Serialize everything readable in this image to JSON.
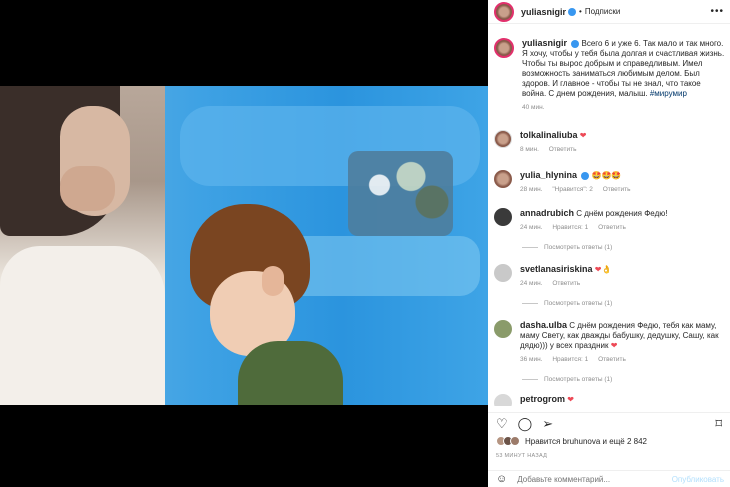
{
  "post": {
    "author": "yuliasnigir",
    "follow_label": "Подписки",
    "caption": "Всего 6 и уже 6. Так мало и так много. Я хочу, чтобы у тебя была долгая и счастливая жизнь. Чтобы ты вырос добрым и справедливым. Имел возможность заниматься любимым делом. Был здоров. И главное - чтобы ты не знал, что такое война. С днем рождения, малыш.",
    "hashtag": "#мирумир",
    "caption_time": "40 мин."
  },
  "comments": [
    {
      "user": "tolkalinaliuba",
      "text": "",
      "emoji": "❤",
      "time": "8 мин.",
      "reply": "Ответить",
      "likes": ""
    },
    {
      "user": "yulia_hlynina",
      "text": "",
      "emoji": "🤩🤩🤩",
      "time": "28 мин.",
      "likes": "\"Нравится\": 2",
      "reply": "Ответить"
    },
    {
      "user": "annadrubich",
      "text": "С днём рождения Федю!",
      "time": "24 мин.",
      "likes": "Нравится: 1",
      "reply": "Ответить",
      "replies": "Посмотреть ответы (1)"
    },
    {
      "user": "svetlanasiriskina",
      "text": "",
      "emoji": "❤👌",
      "time": "24 мин.",
      "reply": "Ответить",
      "replies": "Посмотреть ответы (1)"
    },
    {
      "user": "dasha.ulba",
      "text": "С днём рождения Федю, тебя как маму, маму Свету, как дважды бабушку, дедушку, Сашу, как дядю))) у всех праздник",
      "emoji": "❤",
      "time": "36 мин.",
      "likes": "Нравится: 1",
      "reply": "Ответить",
      "replies": "Посмотреть ответы (1)"
    },
    {
      "user": "petrogrom",
      "text": "",
      "emoji": "❤",
      "time": "",
      "reply": ""
    }
  ],
  "likes_text": "Нравится bruhunova и ещё 2 842",
  "posted_time": "53 МИНУТ НАЗАД",
  "add_comment": {
    "placeholder": "Добавьте комментарий...",
    "post_label": "Опубликовать"
  },
  "icons": {
    "more": "more-icon",
    "like": "heart-icon",
    "comment": "comment-icon",
    "share": "share-icon",
    "save": "bookmark-icon",
    "emoji": "emoji-icon"
  }
}
